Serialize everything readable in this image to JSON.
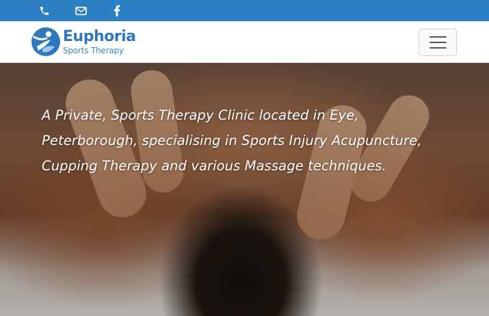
{
  "topbar": {
    "icons": [
      "phone-icon",
      "envelope-icon",
      "facebook-icon"
    ],
    "background": "#2c7fc3"
  },
  "header": {
    "logo": {
      "name": "Euphoria",
      "tagline": "Sports Therapy",
      "color": "#2f78bb"
    },
    "menu_icon": "hamburger-icon"
  },
  "hero": {
    "text": "A Private, Sports Therapy Clinic located in Eye, Peterborough, specialising in Sports Injury Acupuncture, Cupping Therapy and various Massage techniques."
  }
}
